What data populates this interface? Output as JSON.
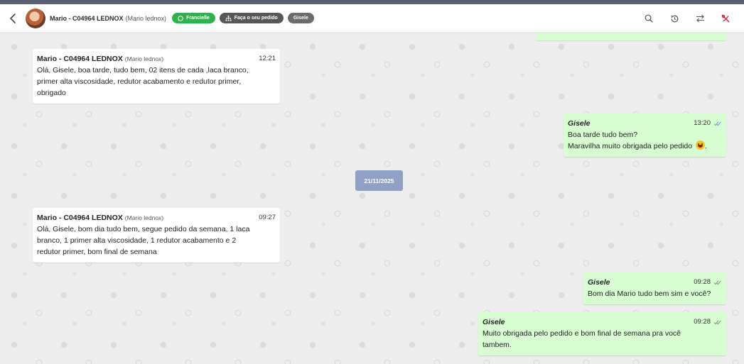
{
  "header": {
    "contact_name": "Mario - C04964 LEDNOX",
    "contact_sub": "(Mario lednox)",
    "tag_whatsapp": "Francielle",
    "tag_order": "Faça o seu pedido",
    "tag_agent": "Gisele"
  },
  "icons": {
    "back": "back-arrow-icon",
    "search": "search-icon",
    "history": "history-icon",
    "transfer": "transfer-icon",
    "close_ticket": "close-ticket-icon"
  },
  "colors": {
    "accent": "#5a6175",
    "incoming_bubble": "#ffffff",
    "outgoing_bubble": "#d8fdd3",
    "date_chip": "#8fa0c3",
    "whatsapp_tag": "#2fb24c",
    "read_ticks": "#5fa3d8",
    "close_icon": "#d8213f"
  },
  "date_separator": "21/11/2025",
  "messages": [
    {
      "sender": "Mario - C04964 LEDNOX",
      "sender_sub": "(Mario lednox)",
      "time": "12:21",
      "lines": [
        "Olá, Gisele, boa tarde, tudo bem, 02 itens de cada ,laca branco,",
        "primer alta viscosidade, redutor acabamento e redutor primer,",
        "obrigado"
      ]
    },
    {
      "sender": "Gisele",
      "time": "13:20",
      "lines": [
        "Boa tarde tudo bem?",
        "Maravilha muito obrigada pelo pedido",
        "."
      ]
    },
    {
      "sender": "Mario - C04964 LEDNOX",
      "sender_sub": "(Mario lednox)",
      "time": "09:27",
      "lines": [
        "Olá, Gisele, bom dia tudo bem, segue pedido da semana, 1 laca",
        "branco, 1 primer alta viscosidade, 1 redutor acabamento e 2",
        "redutor primer, bom final de semana"
      ]
    },
    {
      "sender": "Gisele",
      "time": "09:28",
      "lines": [
        "Bom dia Mario tudo bem sim e você?"
      ]
    },
    {
      "sender": "Gisele",
      "time": "09:28",
      "lines": [
        "Muito obrigada pelo pedido e bom final de semana pra você",
        "tambem."
      ]
    }
  ]
}
